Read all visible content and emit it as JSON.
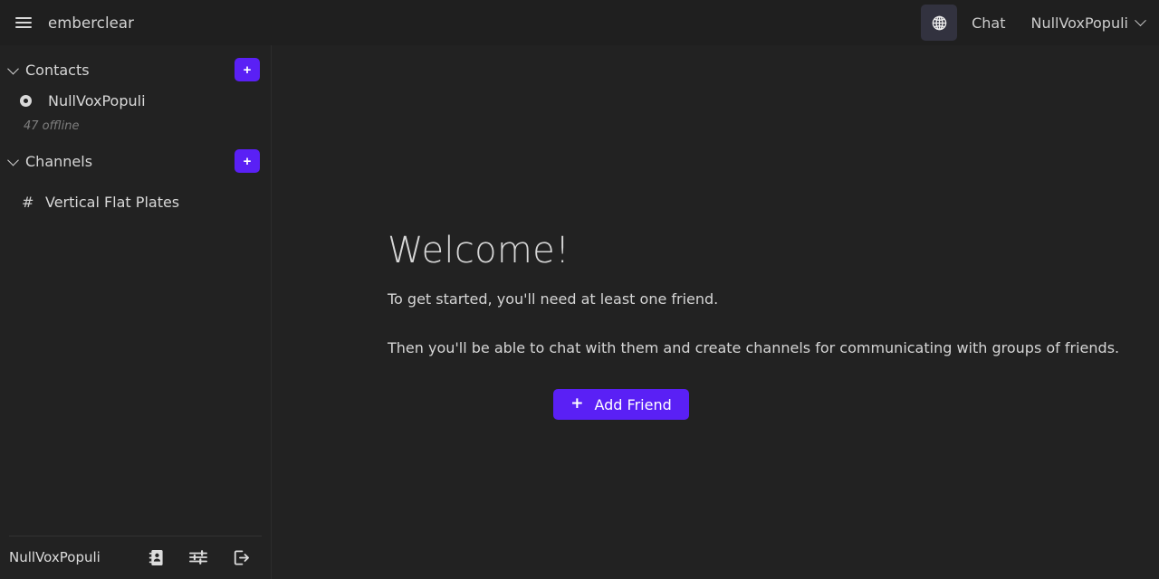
{
  "header": {
    "menu_icon": "hamburger-icon",
    "brand": "emberclear",
    "globe_icon": "globe-icon",
    "chat_label": "Chat",
    "user_label": "NullVoxPopuli",
    "user_chevron_icon": "chevron-down-icon"
  },
  "sidebar": {
    "contacts": {
      "title": "Contacts",
      "chevron_icon": "chevron-down-icon",
      "add_label": "+",
      "items": [
        {
          "name": "NullVoxPopuli",
          "status_icon": "status-dot-offline"
        }
      ],
      "offline_note": "47 offline"
    },
    "channels": {
      "title": "Channels",
      "chevron_icon": "chevron-down-icon",
      "add_label": "+",
      "items": [
        {
          "hash": "#",
          "name": "Vertical Flat Plates"
        }
      ]
    },
    "footer": {
      "user_label": "NullVoxPopuli",
      "icons": [
        {
          "name": "contacts-book-icon"
        },
        {
          "name": "settings-sliders-icon"
        },
        {
          "name": "logout-icon"
        }
      ]
    }
  },
  "main": {
    "title": "Welcome!",
    "line1": "To get started, you'll need at least one friend.",
    "line2": "Then you'll be able to chat with them and create channels for communicating with groups of friends.",
    "cta": {
      "plus": "+",
      "label": "Add Friend"
    }
  },
  "colors": {
    "accent": "#5a20f5",
    "background": "#222222",
    "header_background": "#1f1f1f",
    "globe_button_background": "#32323f",
    "text_primary": "#d8d8d8",
    "text_muted": "#7e7e7e"
  }
}
